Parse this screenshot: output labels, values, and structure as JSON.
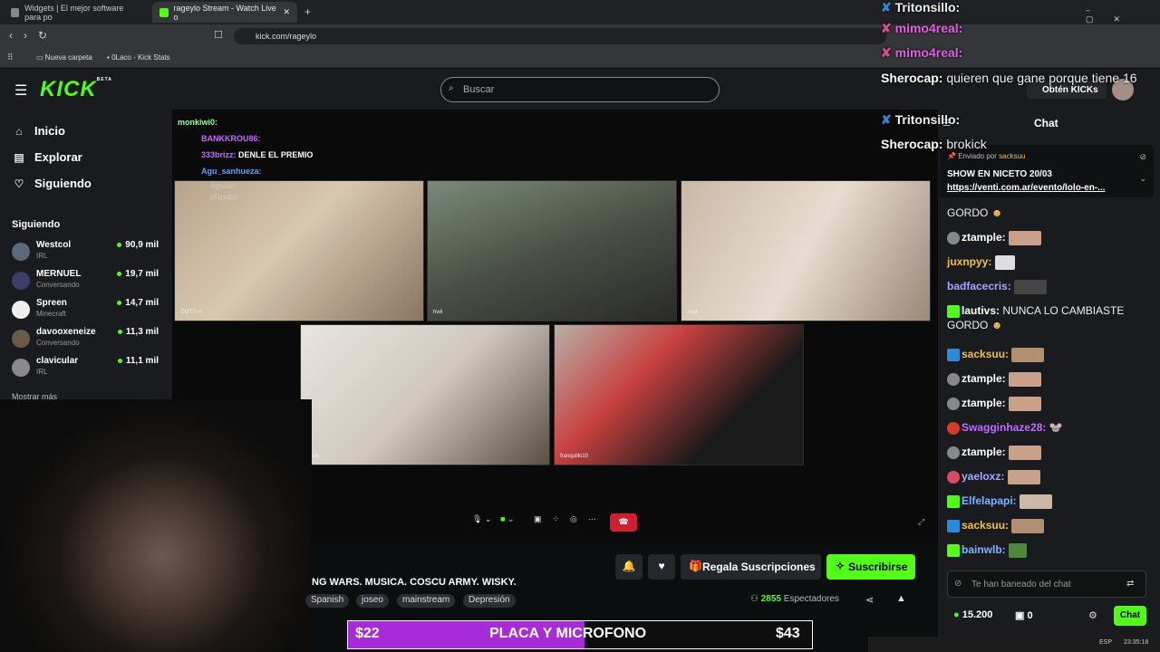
{
  "browser": {
    "tabs": [
      {
        "title": "Widgets | El mejor software para po"
      },
      {
        "title": "rageylo Stream - Watch Live o"
      }
    ],
    "url": "kick.com/rageylo",
    "bookmarks": [
      "Nueva carpeta",
      "0Laco - Kick Stats"
    ]
  },
  "header": {
    "logo": "KICK",
    "logo_badge": "BETA",
    "search_placeholder": "Buscar",
    "kicks_label": "Obtén KICKs"
  },
  "sidebar": {
    "nav": [
      {
        "label": "Inicio",
        "icon": "home-icon"
      },
      {
        "label": "Explorar",
        "icon": "compass-icon"
      },
      {
        "label": "Siguiendo",
        "icon": "heart-icon"
      }
    ],
    "following_title": "Siguiendo",
    "following": [
      {
        "name": "Westcol",
        "category": "IRL",
        "viewers": "90,9 mil"
      },
      {
        "name": "MERNUEL",
        "category": "Conversando",
        "viewers": "19,7 mil"
      },
      {
        "name": "Spreen",
        "category": "Minecraft",
        "viewers": "14,7 mil"
      },
      {
        "name": "davooxeneize",
        "category": "Conversando",
        "viewers": "11,3 mil"
      },
      {
        "name": "clavicular",
        "category": "IRL",
        "viewers": "11,1 mil"
      }
    ],
    "show_more": "Mostrar más"
  },
  "stream": {
    "tiles": [
      "GOTTI A",
      "hwii",
      "niga",
      "Fiedy",
      "franquillo10"
    ],
    "overlay_chat": [
      {
        "user": "monkiwi0:",
        "text": ""
      },
      {
        "user": "BANKKROU86:",
        "text": ""
      },
      {
        "user": "333brizz:",
        "text": "DENLE EL PREMIO"
      },
      {
        "user": "Agu_sanhueza:",
        "text": ""
      },
      {
        "user": "Agsabri:",
        "text": ""
      },
      {
        "user": "p0gsabri:",
        "text": ""
      }
    ]
  },
  "info": {
    "gift_label": "Regala Suscripciones",
    "subscribe_label": "Suscribirse",
    "title": "NG WARS. MUSICA. COSCU ARMY. WISKY.",
    "tags": [
      "Spanish",
      "joseo",
      "mainstream",
      "Depresión"
    ],
    "viewers_count": "2855",
    "viewers_label": "Espectadores"
  },
  "goal": {
    "left": "$22",
    "label": "PLACA Y MICROFONO",
    "right": "$43",
    "progress": 0.51
  },
  "overlay_top_chat": [
    {
      "user": "Tritonsillo:",
      "text": ""
    },
    {
      "user": "mimo4real:",
      "text": ""
    },
    {
      "user": "mimo4real:",
      "text": ""
    },
    {
      "user": "Sherocap:",
      "text": "quieren que gane porque tiene 16"
    },
    {
      "user": "Tritonsillo:",
      "text": ""
    },
    {
      "user": "Sherocap:",
      "text": "brokick"
    }
  ],
  "chat": {
    "title": "Chat",
    "pinned_by_label": "Enviado por",
    "pinned_by_user": "sacksuu",
    "pinned_text": "SHOW EN NICETO 20/03",
    "pinned_link": "https://venti.com.ar/evento/lolo-en-...",
    "messages": [
      {
        "user": "",
        "text": "GORDO",
        "color": "#ffffff"
      },
      {
        "user": "ztample:",
        "text": "",
        "color": "#ffffff"
      },
      {
        "user": "juxnpyy:",
        "text": "",
        "color": "#f2c14e"
      },
      {
        "user": "badfacecris:",
        "text": "",
        "color": "#a5a8ff"
      },
      {
        "user": "lautivs:",
        "text": "NUNCA LO CAMBIASTE GORDO",
        "color": "#ffffff"
      },
      {
        "user": "sacksuu:",
        "text": "",
        "color": "#f2c14e"
      },
      {
        "user": "ztample:",
        "text": "",
        "color": "#ffffff"
      },
      {
        "user": "ztample:",
        "text": "",
        "color": "#ffffff"
      },
      {
        "user": "Swagginhaze28:",
        "text": "",
        "color": "#c06cff"
      },
      {
        "user": "ztample:",
        "text": "",
        "color": "#ffffff"
      },
      {
        "user": "yaeloxz:",
        "text": "",
        "color": "#a5a8ff"
      },
      {
        "user": "Elfelapapi:",
        "text": "",
        "color": "#7fb3ff"
      },
      {
        "user": "sacksuu:",
        "text": "",
        "color": "#f2c14e"
      },
      {
        "user": "bainwlb:",
        "text": "",
        "color": "#7fb3ff"
      }
    ],
    "input_placeholder": "Te han baneado del chat",
    "kicks": "15.200",
    "points": "0",
    "send_label": "Chat"
  },
  "taskbar": {
    "lang": "ESP",
    "time": "23:35:18"
  },
  "colors": {
    "accent": "#53fc18",
    "goal_fill": "#a82bd8",
    "end_call": "#d01f2f"
  }
}
